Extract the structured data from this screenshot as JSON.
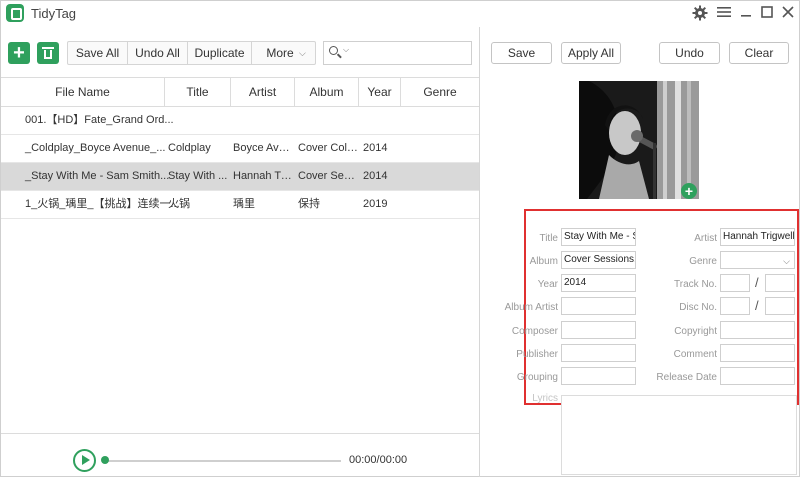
{
  "window": {
    "title": "TidyTag"
  },
  "titlebar_icons": [
    "gear-icon",
    "hamburger-menu-icon",
    "minimize-icon",
    "maximize-icon",
    "close-icon"
  ],
  "toolbar": {
    "save_all": "Save All",
    "undo_all": "Undo All",
    "duplicate": "Duplicate",
    "more": "More"
  },
  "search": {
    "value": "",
    "placeholder": ""
  },
  "table": {
    "columns": [
      "File Name",
      "Title",
      "Artist",
      "Album",
      "Year",
      "Genre"
    ],
    "rows": [
      {
        "file": "001.【HD】Fate_Grand Ord...",
        "title": "",
        "artist": "",
        "album": "",
        "year": "",
        "genre": ""
      },
      {
        "file": "_Coldplay_Boyce Avenue_...",
        "title": "Coldplay",
        "artist": "Boyce Ave...",
        "album": "Cover Coll...",
        "year": "2014",
        "genre": ""
      },
      {
        "file": "_Stay With Me - Sam Smith...",
        "title": "Stay With ...",
        "artist": "Hannah Tri...",
        "album": "Cover Ses...",
        "year": "2014",
        "genre": ""
      },
      {
        "file": "1_火锅_瑀里_【挑战】连续一...",
        "title": "火锅",
        "artist": "瑀里",
        "album": "保持",
        "year": "2019",
        "genre": ""
      }
    ],
    "selected_row": 2
  },
  "player": {
    "time": "00:00/00:00",
    "progress": 0
  },
  "editor": {
    "save": "Save",
    "apply_all": "Apply All",
    "undo": "Undo",
    "clear": "Clear",
    "labels": {
      "title": "Title",
      "album": "Album",
      "year": "Year",
      "album_artist": "Album Artist",
      "composer": "Composer",
      "publisher": "Publisher",
      "grouping": "Grouping",
      "lyrics": "Lyrics",
      "artist": "Artist",
      "genre": "Genre",
      "track_no": "Track No.",
      "disc_no": "Disc No.",
      "copyright": "Copyright",
      "comment": "Comment",
      "release_date": "Release Date"
    },
    "values": {
      "title": "Stay With Me - S",
      "album": "Cover Sessions,",
      "year": "2014",
      "album_artist": "",
      "composer": "",
      "publisher": "",
      "grouping": "",
      "artist": "Hannah Trigwell",
      "genre": "",
      "track_no": "",
      "track_total": "",
      "disc_no": "",
      "disc_total": "",
      "copyright": "",
      "comment": "",
      "release_date": "",
      "lyrics": ""
    }
  },
  "colors": {
    "accent": "#2fa05d",
    "highlight": "#e03030",
    "selected_row": "#d9d9d9"
  }
}
